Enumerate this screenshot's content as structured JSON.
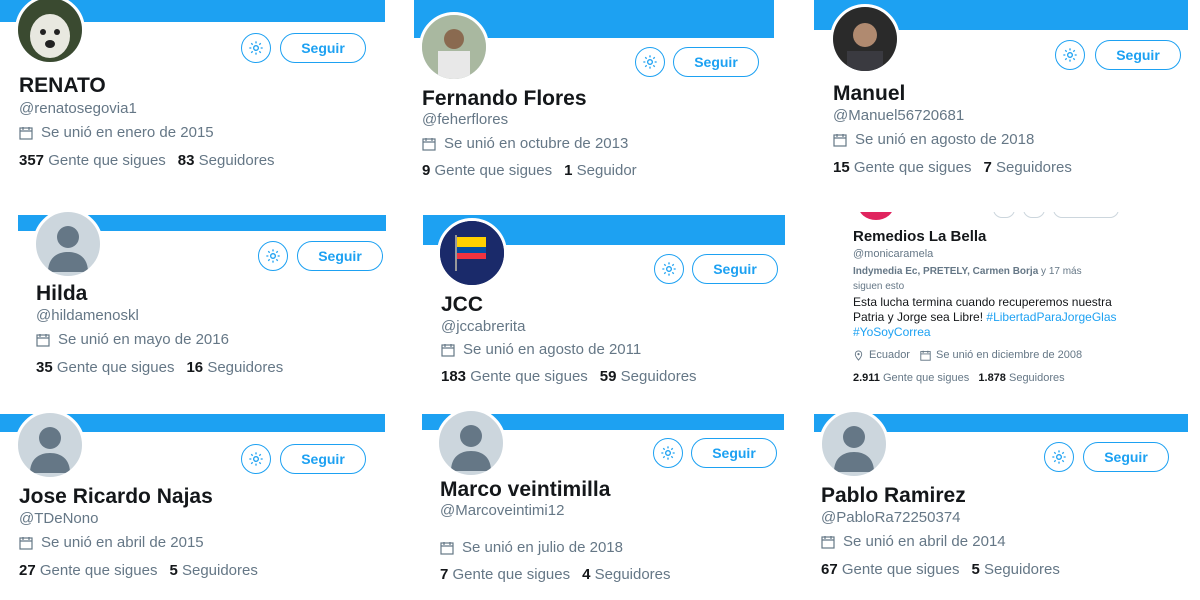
{
  "follow_label": "Seguir",
  "colors": {
    "accent": "#1da1f2",
    "secondary_text": "#657786",
    "primary_text": "#14171a"
  },
  "icons": {
    "gear": "gear-icon",
    "calendar": "calendar-icon",
    "location": "location-pin-icon",
    "avatar": "default-avatar-icon"
  },
  "cards": [
    {
      "name": "RENATO",
      "handle": "@renatosegovia1",
      "joined": "Se unió en enero de 2015",
      "following": "357",
      "following_label": "Gente que sigues",
      "followers": "83",
      "followers_label": "Seguidores"
    },
    {
      "name": "Fernando Flores",
      "handle": "@feherflores",
      "joined": "Se unió en octubre de 2013",
      "following": "9",
      "following_label": "Gente que sigues",
      "followers": "1",
      "followers_label": "Seguidor"
    },
    {
      "name": "Manuel",
      "handle": "@Manuel56720681",
      "joined": "Se unió en agosto de 2018",
      "following": "15",
      "following_label": "Gente que sigues",
      "followers": "7",
      "followers_label": "Seguidores"
    },
    {
      "name": "Hilda",
      "handle": "@hildamenoskl",
      "joined": "Se unió en mayo de 2016",
      "following": "35",
      "following_label": "Gente que sigues",
      "followers": "16",
      "followers_label": "Seguidores"
    },
    {
      "name": "JCC",
      "handle": "@jccabrerita",
      "joined": "Se unió en agosto de 2011",
      "following": "183",
      "following_label": "Gente que sigues",
      "followers": "59",
      "followers_label": "Seguidores"
    },
    {
      "name": "Jose Ricardo Najas",
      "handle": "@TDeNono",
      "joined": "Se unió en abril de 2015",
      "following": "27",
      "following_label": "Gente que sigues",
      "followers": "5",
      "followers_label": "Seguidores"
    },
    {
      "name": "Marco veintimilla",
      "handle": "@Marcoveintimi12",
      "joined": "Se unió en julio de 2018",
      "following": "7",
      "following_label": "Gente que sigues",
      "followers": "4",
      "followers_label": "Seguidores"
    },
    {
      "name": "Pablo Ramirez",
      "handle": "@PabloRa72250374",
      "joined": "Se unió en abril de 2014",
      "following": "67",
      "following_label": "Gente que sigues",
      "followers": "5",
      "followers_label": "Seguidores"
    }
  ],
  "special_card": {
    "name": "Remedios La Bella",
    "handle": "@monicaramela",
    "known_followers": "Indymedia Ec, PRETELY, Carmen Borja",
    "known_suffix": "y",
    "known_more": "17 más",
    "known_tail": "siguen esto",
    "bio_text": "Esta lucha termina cuando recuperemos nuestra Patria y Jorge sea Libre!",
    "bio_tag1": "#LibertadParaJorgeGlas",
    "bio_tag2": "#YoSoyCorrea",
    "location": "Ecuador",
    "joined": "Se unió en diciembre de 2008",
    "following": "2.911",
    "following_label": "Gente que sigues",
    "followers": "1.878",
    "followers_label": "Seguidores"
  }
}
